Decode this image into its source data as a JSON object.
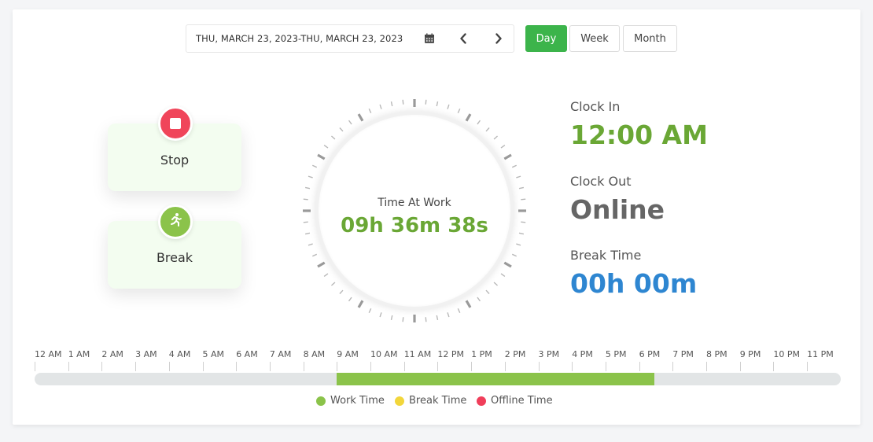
{
  "date_range": {
    "text": "THU, MARCH 23, 2023-THU, MARCH 23, 2023",
    "calendar_icon": "calendar-icon",
    "prev_icon": "chevron-left-icon",
    "next_icon": "chevron-right-icon"
  },
  "periods": [
    {
      "label": "Day",
      "active": true
    },
    {
      "label": "Week",
      "active": false
    },
    {
      "label": "Month",
      "active": false
    }
  ],
  "actions": {
    "stop": {
      "label": "Stop",
      "icon": "stop-icon",
      "color": "#f0455a"
    },
    "break": {
      "label": "Break",
      "icon": "running-person-icon",
      "color": "#8bc34a"
    }
  },
  "dial": {
    "label": "Time At Work",
    "value": "09h 36m 38s"
  },
  "stats": {
    "clock_in": {
      "label": "Clock In",
      "value": "12:00 AM",
      "color": "#6aa735"
    },
    "clock_out": {
      "label": "Clock Out",
      "value": "Online",
      "color": "#666666"
    },
    "break_time": {
      "label": "Break Time",
      "value": "00h 00m",
      "color": "#2e86d1"
    }
  },
  "timeline": {
    "hours": [
      "12 AM",
      "1 AM",
      "2 AM",
      "3 AM",
      "4 AM",
      "5 AM",
      "6 AM",
      "7 AM",
      "8 AM",
      "9 AM",
      "10 AM",
      "11 AM",
      "12 PM",
      "1 PM",
      "2 PM",
      "3 PM",
      "4 PM",
      "5 PM",
      "6 PM",
      "7 PM",
      "8 PM",
      "9 PM",
      "10 PM",
      "11 PM"
    ],
    "work_start_hour": 9.0,
    "work_end_hour": 18.45,
    "colors": {
      "work": "#8bc34a",
      "track": "#e2e5e6"
    }
  },
  "legend": [
    {
      "label": "Work Time",
      "color": "#8bc34a"
    },
    {
      "label": "Break Time",
      "color": "#f2d63b"
    },
    {
      "label": "Offline Time",
      "color": "#f03e5a"
    }
  ]
}
